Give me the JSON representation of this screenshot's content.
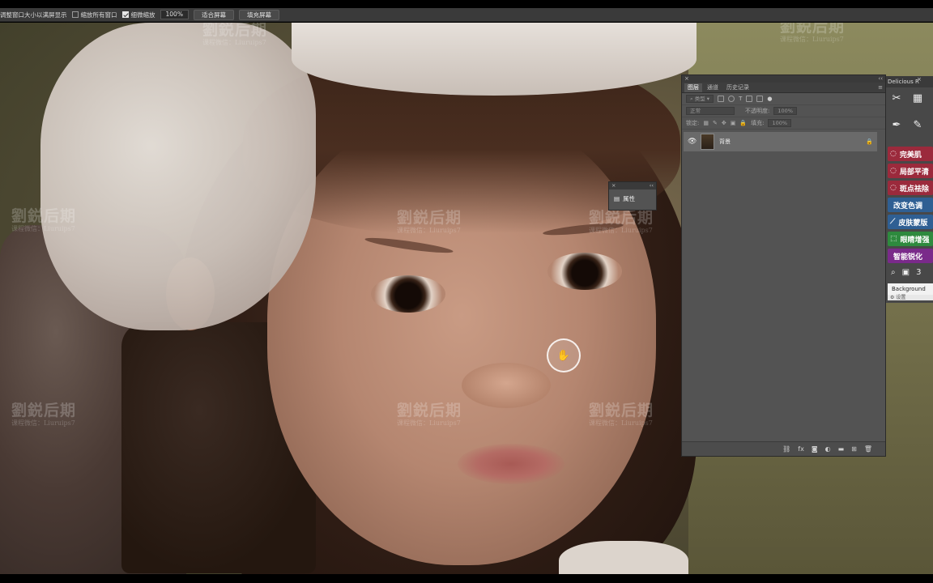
{
  "options_bar": {
    "resize_windows_label": "调整窗口大小以满屏显示",
    "zoom_all_label": "缩放所有窗口",
    "scrubby_zoom_label": "细微缩放",
    "zoom_value": "100%",
    "fit_screen_label": "适合屏幕",
    "fill_screen_label": "填充屏幕"
  },
  "watermark": {
    "title": "劉鋭后期",
    "subtitle": "课程微信：Liuruips7"
  },
  "layers_panel": {
    "tabs": [
      "图层",
      "通道",
      "历史记录"
    ],
    "filter_label": "类型",
    "blend_mode": "正常",
    "opacity_label": "不透明度:",
    "opacity_value": "100%",
    "lock_label": "锁定:",
    "fill_label": "填充:",
    "fill_value": "100%",
    "layer_name": "背景",
    "footer_icons": [
      "link-icon",
      "fx-icon",
      "mask-icon",
      "adjustment-icon",
      "folder-icon",
      "new-layer-icon",
      "trash-icon"
    ]
  },
  "properties_panel": {
    "label": "属性"
  },
  "delicious_panel": {
    "title": "Delicious R",
    "actions": [
      {
        "label": "完美肌",
        "color": "#9b2a3c"
      },
      {
        "label": "局部平清",
        "color": "#9b2a3c"
      },
      {
        "label": "斑点祛除",
        "color": "#9b2a3c"
      },
      {
        "label": "改变色调",
        "color": "#2f5f93"
      },
      {
        "label": "皮肤蒙版",
        "color": "#2f5f93"
      },
      {
        "label": "眼睛增强",
        "color": "#2e8a3e"
      },
      {
        "label": "智能锐化",
        "color": "#7a2a8a"
      }
    ],
    "background_label": "Background",
    "settings_label": "设置"
  }
}
